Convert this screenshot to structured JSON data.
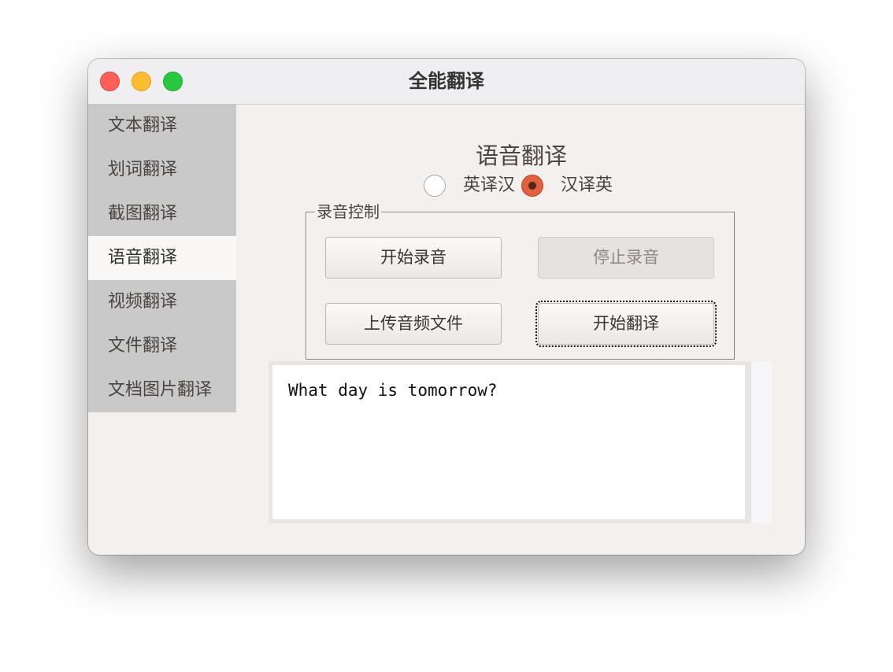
{
  "window": {
    "title": "全能翻译"
  },
  "sidebar": {
    "items": [
      {
        "label": "文本翻译"
      },
      {
        "label": "划词翻译"
      },
      {
        "label": "截图翻译"
      },
      {
        "label": "语音翻译",
        "active": true
      },
      {
        "label": "视频翻译"
      },
      {
        "label": "文件翻译"
      },
      {
        "label": "文档图片翻译"
      }
    ]
  },
  "main": {
    "title": "语音翻译",
    "direction": {
      "options": [
        "英译汉",
        "汉译英"
      ],
      "selected": "汉译英"
    },
    "recording": {
      "legend": "录音控制",
      "start_label": "开始录音",
      "stop_label": "停止录音",
      "upload_label": "上传音频文件",
      "translate_label": "开始翻译"
    },
    "output_text": "What day is tomorrow?"
  },
  "colors": {
    "accent_radio": "#e2603c",
    "sidebar_bg": "#c9c9c9",
    "sidebar_active_bg": "#f8f7f6",
    "window_bg": "#f3f0ee"
  }
}
